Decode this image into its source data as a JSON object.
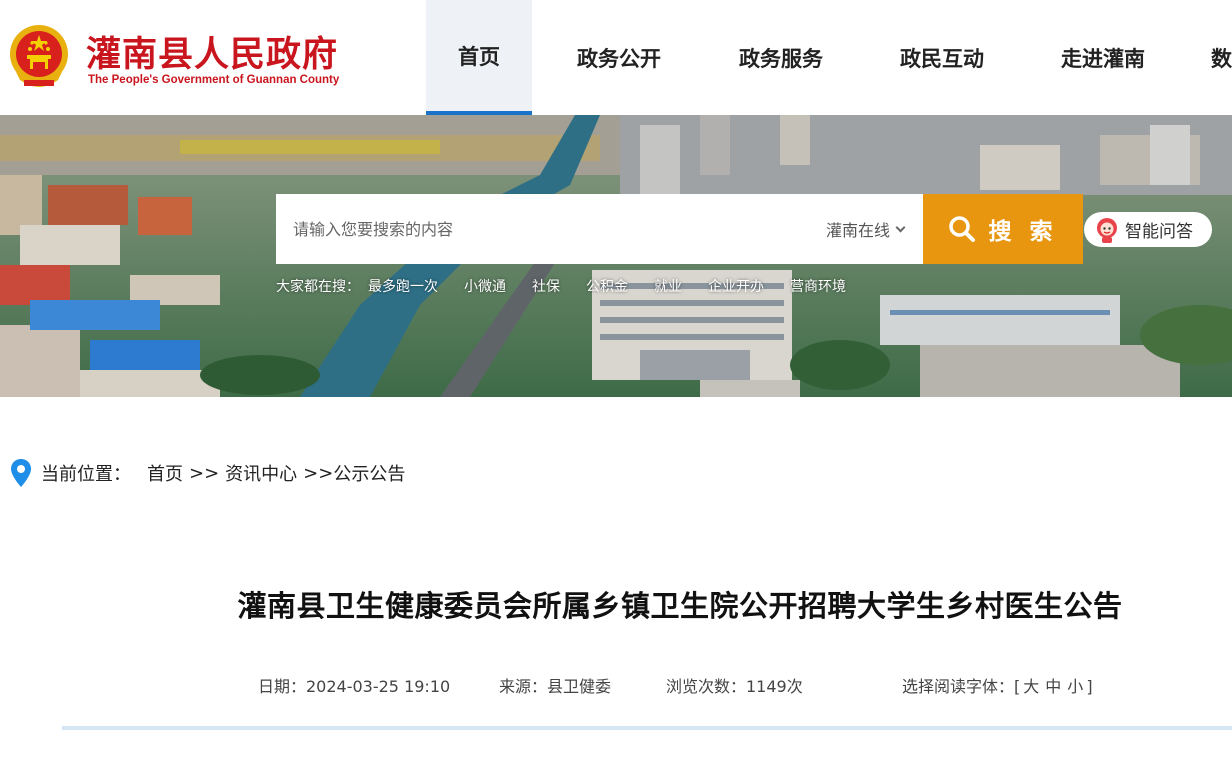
{
  "header": {
    "site_title": "灌南县人民政府",
    "site_subtitle": "The People's Government of Guannan County",
    "nav": [
      {
        "label": "首页",
        "active": true
      },
      {
        "label": "政务公开"
      },
      {
        "label": "政务服务"
      },
      {
        "label": "政民互动"
      },
      {
        "label": "走进灌南"
      },
      {
        "label": "数"
      }
    ]
  },
  "search": {
    "placeholder": "请输入您要搜索的内容",
    "scope": "灌南在线",
    "button_label": "搜 索",
    "ai_label": "智能问答",
    "hot_label": "大家都在搜：",
    "hot_links": [
      "最多跑一次",
      "小微通",
      "社保",
      "公积金",
      "就业",
      "企业开办",
      "营商环境"
    ]
  },
  "breadcrumb": {
    "label": "当前位置：",
    "items": [
      "首页",
      "资讯中心",
      "公示公告"
    ],
    "separator": ">>"
  },
  "article": {
    "title": "灌南县卫生健康委员会所属乡镇卫生院公开招聘大学生乡村医生公告",
    "date": "日期：2024-03-25 19:10",
    "source": "来源：县卫健委",
    "views": "浏览次数：1149次",
    "font_label": "选择阅读字体：",
    "font_sizes": [
      "大",
      "中",
      "小"
    ]
  },
  "colors": {
    "brand_red": "#c9151e",
    "search_orange": "#e8960f",
    "nav_active_bg": "#eef1f5",
    "accent_blue": "#1a73c8"
  }
}
